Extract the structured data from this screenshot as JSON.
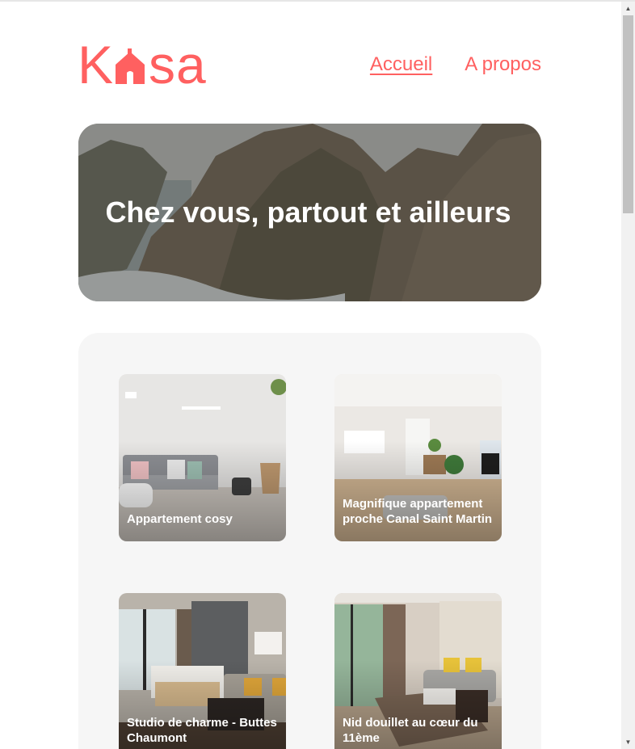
{
  "header": {
    "logo_text_left": "K",
    "logo_text_right": "sa",
    "nav": [
      {
        "label": "Accueil",
        "active": true
      },
      {
        "label": "A propos",
        "active": false
      }
    ]
  },
  "banner": {
    "title": "Chez vous, partout et ailleurs"
  },
  "gallery": {
    "cards": [
      {
        "title": "Appartement cosy"
      },
      {
        "title": "Magnifique appartement proche Canal Saint Martin"
      },
      {
        "title": "Studio de charme - Buttes Chaumont"
      },
      {
        "title": "Nid douillet au cœur du 11ème"
      }
    ]
  },
  "colors": {
    "brand": "#ff6060",
    "gallery_bg": "#f6f6f6"
  }
}
